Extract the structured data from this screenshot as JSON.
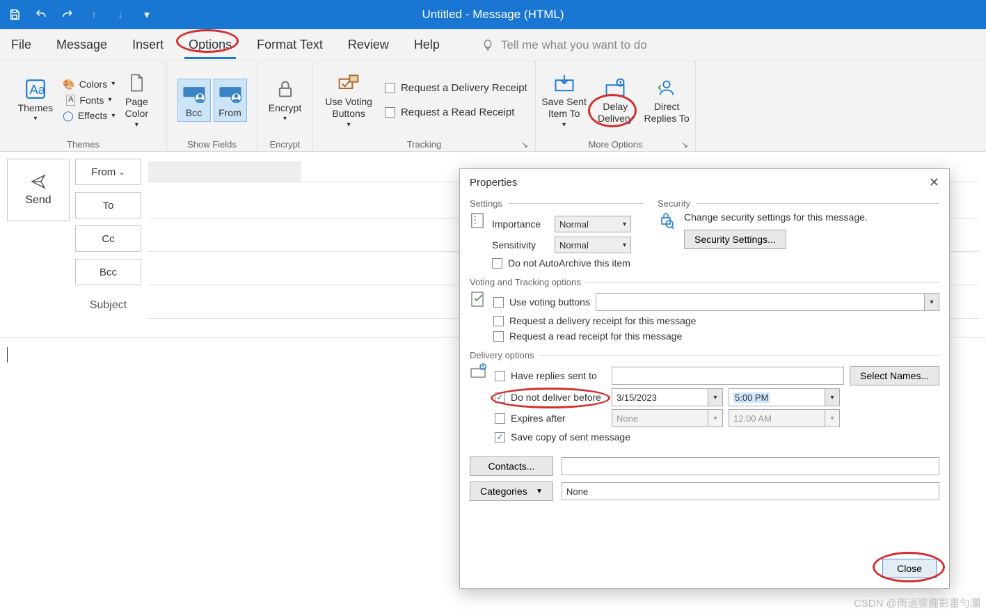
{
  "title": "Untitled  -  Message (HTML)",
  "qat": {
    "save": "save-icon",
    "undo": "undo-icon",
    "redo": "redo-icon",
    "up": "up",
    "down": "down",
    "more": "more"
  },
  "tabs": {
    "file": "File",
    "message": "Message",
    "insert": "Insert",
    "options": "Options",
    "format": "Format Text",
    "review": "Review",
    "help": "Help",
    "tellme": "Tell me what you want to do"
  },
  "ribbon": {
    "themes": {
      "label": "Themes",
      "themes": "Themes",
      "colors": "Colors",
      "fonts": "Fonts",
      "effects": "Effects",
      "pagecolor": "Page\nColor"
    },
    "showfields": {
      "label": "Show Fields",
      "bcc": "Bcc",
      "from": "From"
    },
    "encrypt": {
      "label": "Encrypt",
      "encrypt": "Encrypt"
    },
    "tracking": {
      "label": "Tracking",
      "voting": "Use Voting\nButtons",
      "reqdel": "Request a Delivery Receipt",
      "reqread": "Request a Read Receipt"
    },
    "moreopts": {
      "label": "More Options",
      "savesent": "Save Sent\nItem To",
      "delay": "Delay\nDelivery",
      "direct": "Direct\nReplies To"
    }
  },
  "compose": {
    "send": "Send",
    "from": "From",
    "to": "To",
    "cc": "Cc",
    "bcc": "Bcc",
    "subject": "Subject",
    "fromval": "",
    "toval": "",
    "ccval": "",
    "bccval": "",
    "subjval": ""
  },
  "dialog": {
    "title": "Properties",
    "settings": {
      "legend": "Settings",
      "importance": "Importance",
      "importance_val": "Normal",
      "sensitivity": "Sensitivity",
      "sensitivity_val": "Normal",
      "noarchive": "Do not AutoArchive this item"
    },
    "security": {
      "legend": "Security",
      "text": "Change security settings for this message.",
      "btn": "Security Settings..."
    },
    "voting": {
      "legend": "Voting and Tracking options",
      "usevoting": "Use voting buttons",
      "voting_val": "",
      "reqdel": "Request a delivery receipt for this message",
      "reqread": "Request a read receipt for this message"
    },
    "delivery": {
      "legend": "Delivery options",
      "replies": "Have replies sent to",
      "replies_val": "",
      "selectnames": "Select Names...",
      "donotdeliver": "Do not deliver before",
      "date": "3/15/2023",
      "time": "5:00 PM",
      "expires": "Expires after",
      "exp_date": "None",
      "exp_time": "12:00 AM",
      "savecopy": "Save copy of sent message"
    },
    "contacts": "Contacts...",
    "categories": "Categories",
    "categories_val": "None",
    "close": "Close"
  },
  "watermark": "CSDN @雨過朦朧影畫勻瀾"
}
